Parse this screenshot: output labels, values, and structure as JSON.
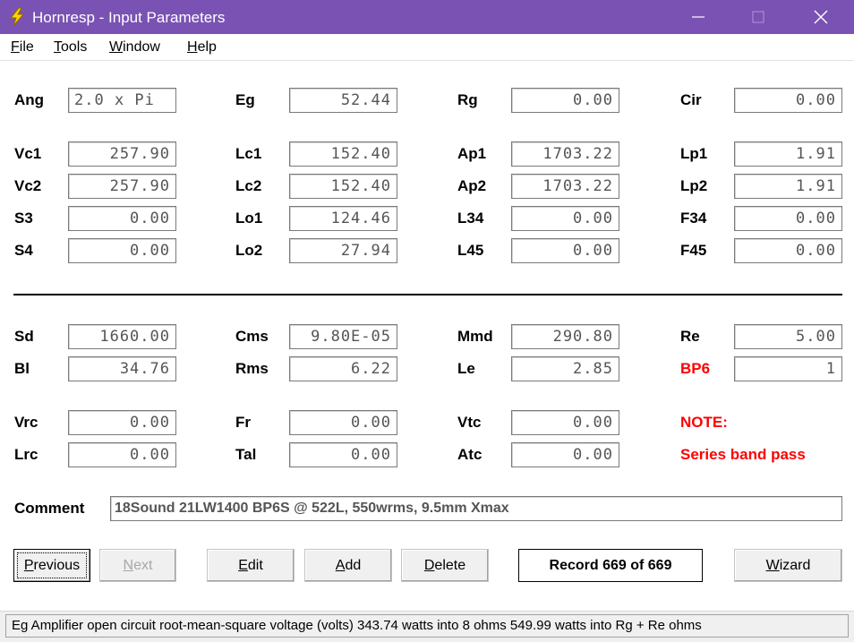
{
  "window": {
    "title": "Hornresp - Input Parameters",
    "titlebar_color": "#7a52b3",
    "app_icon": "lightning-bolt-icon"
  },
  "menu": {
    "items": [
      {
        "first": "F",
        "rest": "ile"
      },
      {
        "first": "T",
        "rest": "ools"
      },
      {
        "first": "W",
        "rest": "indow"
      },
      {
        "first": "H",
        "rest": "elp"
      }
    ]
  },
  "params": {
    "Ang": {
      "label": "Ang",
      "value": "2.0 x Pi"
    },
    "Eg": {
      "label": "Eg",
      "value": "52.44"
    },
    "Rg": {
      "label": "Rg",
      "value": "0.00"
    },
    "Cir": {
      "label": "Cir",
      "value": "0.00"
    },
    "Vc1": {
      "label": "Vc1",
      "value": "257.90"
    },
    "Lc1": {
      "label": "Lc1",
      "value": "152.40"
    },
    "Ap1": {
      "label": "Ap1",
      "value": "1703.22"
    },
    "Lp1": {
      "label": "Lp1",
      "value": "1.91"
    },
    "Vc2": {
      "label": "Vc2",
      "value": "257.90"
    },
    "Lc2": {
      "label": "Lc2",
      "value": "152.40"
    },
    "Ap2": {
      "label": "Ap2",
      "value": "1703.22"
    },
    "Lp2": {
      "label": "Lp2",
      "value": "1.91"
    },
    "S3": {
      "label": "S3",
      "value": "0.00"
    },
    "Lo1": {
      "label": "Lo1",
      "value": "124.46"
    },
    "L34": {
      "label": "L34",
      "value": "0.00"
    },
    "F34": {
      "label": "F34",
      "value": "0.00"
    },
    "S4": {
      "label": "S4",
      "value": "0.00"
    },
    "Lo2": {
      "label": "Lo2",
      "value": "27.94"
    },
    "L45": {
      "label": "L45",
      "value": "0.00"
    },
    "F45": {
      "label": "F45",
      "value": "0.00"
    },
    "Sd": {
      "label": "Sd",
      "value": "1660.00"
    },
    "Cms": {
      "label": "Cms",
      "value": "9.80E-05"
    },
    "Mmd": {
      "label": "Mmd",
      "value": "290.80"
    },
    "Re": {
      "label": "Re",
      "value": "5.00"
    },
    "Bl": {
      "label": "Bl",
      "value": "34.76"
    },
    "Rms": {
      "label": "Rms",
      "value": "6.22"
    },
    "Le": {
      "label": "Le",
      "value": "2.85"
    },
    "BP6": {
      "label": "BP6",
      "value": "1"
    },
    "Vrc": {
      "label": "Vrc",
      "value": "0.00"
    },
    "Fr": {
      "label": "Fr",
      "value": "0.00"
    },
    "Vtc": {
      "label": "Vtc",
      "value": "0.00"
    },
    "Lrc": {
      "label": "Lrc",
      "value": "0.00"
    },
    "Tal": {
      "label": "Tal",
      "value": "0.00"
    },
    "Atc": {
      "label": "Atc",
      "value": "0.00"
    }
  },
  "note": {
    "label": "NOTE:",
    "text": "Series band pass",
    "color": "#ff0000"
  },
  "comment": {
    "label": "Comment",
    "value": "18Sound 21LW1400 BP6S @ 522L, 550wrms, 9.5mm Xmax"
  },
  "buttons": {
    "previous": {
      "first": "P",
      "rest": "revious"
    },
    "next": {
      "first": "N",
      "rest": "ext"
    },
    "edit": {
      "first": "E",
      "rest": "dit"
    },
    "add": {
      "first": "A",
      "rest": "dd"
    },
    "delete": {
      "first": "D",
      "rest": "elete"
    },
    "wizard": {
      "first": "W",
      "rest": "izard"
    }
  },
  "record": "Record 669 of 669",
  "status": "Eg   Amplifier open circuit root-mean-square voltage  (volts)   343.74 watts into 8 ohms   549.99 watts into Rg + Re ohms"
}
